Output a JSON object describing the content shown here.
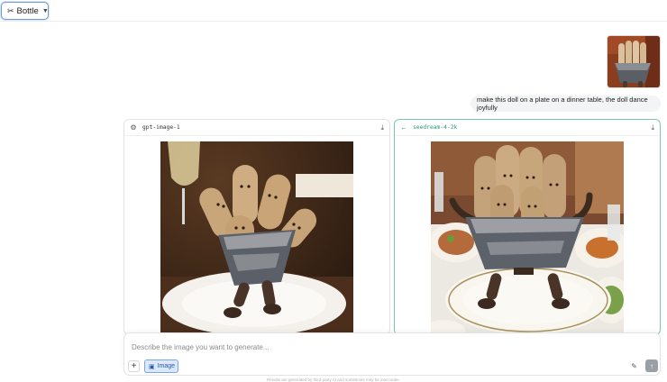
{
  "header": {
    "model_selector": {
      "icon": "bottle-icon",
      "label": "Bottle",
      "chevron": "chevron-down-icon"
    }
  },
  "conversation": {
    "user_message": "make this doll on a plate on a dinner table, the doll dance joyfully"
  },
  "results": [
    {
      "model": "gpt-image-1",
      "icon": "openai-icon",
      "download_icon": "download-icon"
    },
    {
      "model": "seedream-4-2k",
      "icon": "back-arrow-icon",
      "download_icon": "download-icon"
    }
  ],
  "composer": {
    "placeholder": "Describe the image you want to generate...",
    "image_chip_label": "Image",
    "plus_label": "+",
    "send_icon": "arrow-up-icon",
    "tool_icon": "brush-icon"
  },
  "footer": {
    "disclaimer": "Results are generated by third-party AI and sometimes may be inaccurate."
  },
  "colors": {
    "selected_panel_border": "#7cc7ae",
    "accent_blue": "#6b9bd9",
    "model_green": "#2e9b76"
  }
}
